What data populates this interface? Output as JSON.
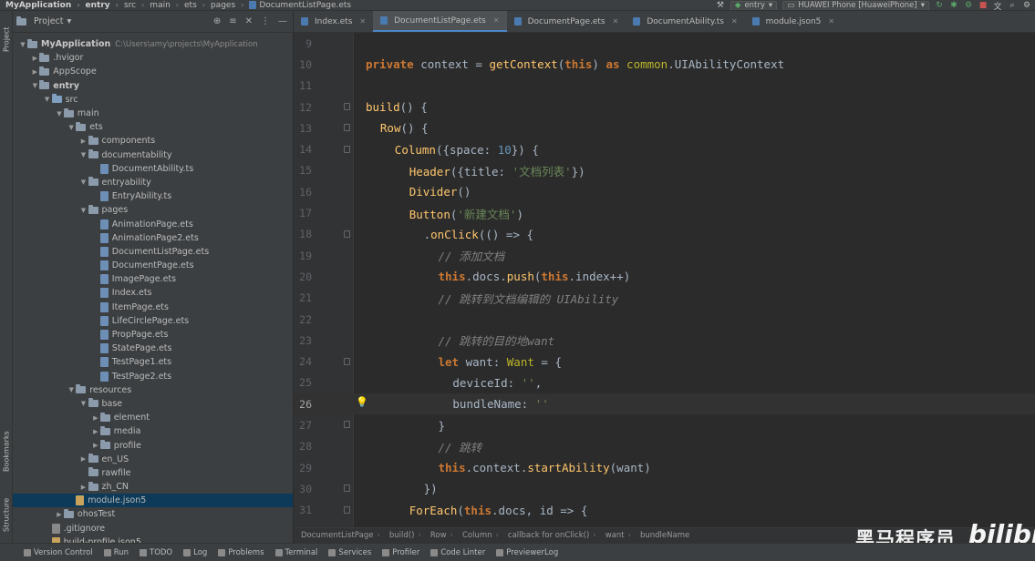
{
  "breadcrumb": [
    "MyApplication",
    "entry",
    "src",
    "main",
    "ets",
    "pages",
    "DocumentListPage.ets"
  ],
  "run_config": "entry",
  "device": "HUAWEI Phone [HuaweiPhone]",
  "project_panel": {
    "title": "Project",
    "tree": [
      {
        "label": "MyApplication",
        "path": "C:\\Users\\amy\\projects\\MyApplication",
        "depth": 0,
        "type": "folder",
        "expanded": true,
        "bold": true
      },
      {
        "label": ".hvigor",
        "depth": 1,
        "type": "folder",
        "expanded": false
      },
      {
        "label": "AppScope",
        "depth": 1,
        "type": "folder",
        "expanded": false
      },
      {
        "label": "entry",
        "depth": 1,
        "type": "folder",
        "expanded": true,
        "bold": true
      },
      {
        "label": "src",
        "depth": 2,
        "type": "folder",
        "expanded": true
      },
      {
        "label": "main",
        "depth": 3,
        "type": "folder",
        "expanded": true
      },
      {
        "label": "ets",
        "depth": 4,
        "type": "folder",
        "expanded": true
      },
      {
        "label": "components",
        "depth": 5,
        "type": "folder",
        "expanded": false
      },
      {
        "label": "documentability",
        "depth": 5,
        "type": "folder",
        "expanded": true
      },
      {
        "label": "DocumentAbility.ts",
        "depth": 6,
        "type": "file"
      },
      {
        "label": "entryability",
        "depth": 5,
        "type": "folder",
        "expanded": true
      },
      {
        "label": "EntryAbility.ts",
        "depth": 6,
        "type": "file"
      },
      {
        "label": "pages",
        "depth": 5,
        "type": "folder",
        "expanded": true
      },
      {
        "label": "AnimationPage.ets",
        "depth": 6,
        "type": "file"
      },
      {
        "label": "AnimationPage2.ets",
        "depth": 6,
        "type": "file"
      },
      {
        "label": "DocumentListPage.ets",
        "depth": 6,
        "type": "file"
      },
      {
        "label": "DocumentPage.ets",
        "depth": 6,
        "type": "file"
      },
      {
        "label": "ImagePage.ets",
        "depth": 6,
        "type": "file"
      },
      {
        "label": "Index.ets",
        "depth": 6,
        "type": "file"
      },
      {
        "label": "ItemPage.ets",
        "depth": 6,
        "type": "file"
      },
      {
        "label": "LifeCirclePage.ets",
        "depth": 6,
        "type": "file"
      },
      {
        "label": "PropPage.ets",
        "depth": 6,
        "type": "file"
      },
      {
        "label": "StatePage.ets",
        "depth": 6,
        "type": "file"
      },
      {
        "label": "TestPage1.ets",
        "depth": 6,
        "type": "file"
      },
      {
        "label": "TestPage2.ets",
        "depth": 6,
        "type": "file"
      },
      {
        "label": "resources",
        "depth": 4,
        "type": "folder",
        "expanded": true
      },
      {
        "label": "base",
        "depth": 5,
        "type": "folder",
        "expanded": true
      },
      {
        "label": "element",
        "depth": 6,
        "type": "folder",
        "expanded": false
      },
      {
        "label": "media",
        "depth": 6,
        "type": "folder",
        "expanded": false
      },
      {
        "label": "profile",
        "depth": 6,
        "type": "folder",
        "expanded": false
      },
      {
        "label": "en_US",
        "depth": 5,
        "type": "folder",
        "expanded": false
      },
      {
        "label": "rawfile",
        "depth": 5,
        "type": "folder",
        "expanded": null
      },
      {
        "label": "zh_CN",
        "depth": 5,
        "type": "folder",
        "expanded": false
      },
      {
        "label": "module.json5",
        "depth": 4,
        "type": "json",
        "selected": true
      },
      {
        "label": "ohosTest",
        "depth": 3,
        "type": "folder",
        "expanded": false
      },
      {
        "label": ".gitignore",
        "depth": 2,
        "type": "git"
      },
      {
        "label": "build-profile.json5",
        "depth": 2,
        "type": "json"
      }
    ]
  },
  "tabs": [
    {
      "label": "Index.ets",
      "active": false
    },
    {
      "label": "DocumentListPage.ets",
      "active": true
    },
    {
      "label": "DocumentPage.ets",
      "active": false
    },
    {
      "label": "DocumentAbility.ts",
      "active": false
    },
    {
      "label": "module.json5",
      "active": false
    }
  ],
  "editor": {
    "current_line": 26,
    "lines": [
      {
        "n": 9,
        "indent": 0,
        "tokens": []
      },
      {
        "n": 10,
        "indent": 0,
        "tokens": [
          [
            "kw",
            "private"
          ],
          [
            "p",
            " context = "
          ],
          [
            "fn",
            "getContext"
          ],
          [
            "p",
            "("
          ],
          [
            "kw",
            "this"
          ],
          [
            "p",
            ") "
          ],
          [
            "kw",
            "as"
          ],
          [
            "p",
            " "
          ],
          [
            "mod",
            "common"
          ],
          [
            "p",
            ".UIAbilityContext"
          ]
        ]
      },
      {
        "n": 11,
        "indent": 0,
        "tokens": []
      },
      {
        "n": 12,
        "indent": 0,
        "tokens": [
          [
            "fn",
            "build"
          ],
          [
            "p",
            "() {"
          ]
        ],
        "fold": true
      },
      {
        "n": 13,
        "indent": 1,
        "tokens": [
          [
            "fn",
            "Row"
          ],
          [
            "p",
            "() {"
          ]
        ],
        "fold": true
      },
      {
        "n": 14,
        "indent": 2,
        "tokens": [
          [
            "fn",
            "Column"
          ],
          [
            "p",
            "({space: "
          ],
          [
            "num",
            "10"
          ],
          [
            "p",
            "}) {"
          ]
        ],
        "fold": true
      },
      {
        "n": 15,
        "indent": 3,
        "tokens": [
          [
            "fn",
            "Header"
          ],
          [
            "p",
            "({title: "
          ],
          [
            "str",
            "'文档列表'"
          ],
          [
            "p",
            "})"
          ]
        ]
      },
      {
        "n": 16,
        "indent": 3,
        "tokens": [
          [
            "fn",
            "Divider"
          ],
          [
            "p",
            "()"
          ]
        ]
      },
      {
        "n": 17,
        "indent": 3,
        "tokens": [
          [
            "fn",
            "Button"
          ],
          [
            "p",
            "("
          ],
          [
            "str",
            "'新建文档'"
          ],
          [
            "p",
            ")"
          ]
        ]
      },
      {
        "n": 18,
        "indent": 4,
        "tokens": [
          [
            "p",
            "."
          ],
          [
            "fn",
            "onClick"
          ],
          [
            "p",
            "(() => {"
          ]
        ],
        "fold": true
      },
      {
        "n": 19,
        "indent": 5,
        "tokens": [
          [
            "cm",
            "// 添加文档"
          ]
        ]
      },
      {
        "n": 20,
        "indent": 5,
        "tokens": [
          [
            "kw",
            "this"
          ],
          [
            "p",
            ".docs."
          ],
          [
            "fn",
            "push"
          ],
          [
            "p",
            "("
          ],
          [
            "kw",
            "this"
          ],
          [
            "p",
            ".index++)"
          ]
        ]
      },
      {
        "n": 21,
        "indent": 5,
        "tokens": [
          [
            "cm",
            "// 跳转到文档编辑的 UIAbility"
          ]
        ]
      },
      {
        "n": 22,
        "indent": 0,
        "tokens": []
      },
      {
        "n": 23,
        "indent": 5,
        "tokens": [
          [
            "cm",
            "// 跳转的目的地want"
          ]
        ]
      },
      {
        "n": 24,
        "indent": 5,
        "tokens": [
          [
            "kw",
            "let"
          ],
          [
            "p",
            " want: "
          ],
          [
            "mod",
            "Want"
          ],
          [
            "p",
            " = {"
          ]
        ],
        "fold": true
      },
      {
        "n": 25,
        "indent": 6,
        "tokens": [
          [
            "p",
            "deviceId: "
          ],
          [
            "str",
            "''"
          ],
          [
            "p",
            ","
          ]
        ]
      },
      {
        "n": 26,
        "indent": 6,
        "tokens": [
          [
            "p",
            "bundleName: "
          ],
          [
            "str",
            "''"
          ]
        ],
        "bulb": true
      },
      {
        "n": 27,
        "indent": 5,
        "tokens": [
          [
            "p",
            "}"
          ]
        ],
        "fold": true
      },
      {
        "n": 28,
        "indent": 5,
        "tokens": [
          [
            "cm",
            "// 跳转"
          ]
        ]
      },
      {
        "n": 29,
        "indent": 5,
        "tokens": [
          [
            "kw",
            "this"
          ],
          [
            "p",
            ".context."
          ],
          [
            "fn",
            "startAbility"
          ],
          [
            "p",
            "(want)"
          ]
        ]
      },
      {
        "n": 30,
        "indent": 4,
        "tokens": [
          [
            "p",
            "})"
          ]
        ],
        "fold": true
      },
      {
        "n": 31,
        "indent": 3,
        "tokens": [
          [
            "fn",
            "ForEach"
          ],
          [
            "p",
            "("
          ],
          [
            "kw",
            "this"
          ],
          [
            "p",
            ".docs, id => {"
          ]
        ],
        "fold": true
      }
    ]
  },
  "editor_breadcrumb": [
    "DocumentListPage",
    "build()",
    "Row",
    "Column",
    "callback for onClick()",
    "want",
    "bundleName"
  ],
  "left_tool_tabs": {
    "project": "Project",
    "bookmarks": "Bookmarks",
    "structure": "Structure"
  },
  "status_bar": [
    {
      "label": "Version Control",
      "icon": "branch-icon"
    },
    {
      "label": "Run",
      "icon": "run-icon"
    },
    {
      "label": "TODO",
      "icon": "todo-icon"
    },
    {
      "label": "Log",
      "icon": "log-icon"
    },
    {
      "label": "Problems",
      "icon": "problems-icon"
    },
    {
      "label": "Terminal",
      "icon": "terminal-icon"
    },
    {
      "label": "Services",
      "icon": "services-icon"
    },
    {
      "label": "Profiler",
      "icon": "profiler-icon"
    },
    {
      "label": "Code Linter",
      "icon": "linter-icon"
    },
    {
      "label": "PreviewerLog",
      "icon": "previewer-icon"
    }
  ],
  "watermark": {
    "text": "黑马程序员",
    "logo": "bilibili"
  },
  "colors": {
    "background": "#2b2b2b",
    "panel": "#3c3f41",
    "keyword": "#cc7832",
    "function": "#ffc66d",
    "string": "#6a8759",
    "number": "#6897bb",
    "comment": "#808080",
    "selection": "#0d3a58"
  }
}
